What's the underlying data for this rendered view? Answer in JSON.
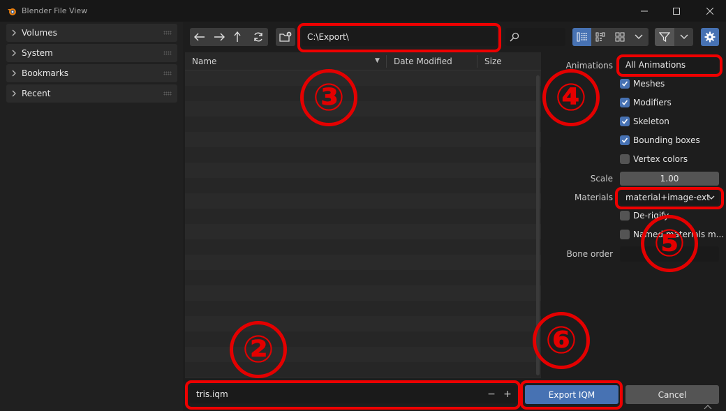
{
  "window": {
    "title": "Blender File View",
    "minimize_glyph": "—",
    "maximize_glyph": "☐",
    "close_glyph": "✕"
  },
  "sidebar": {
    "items": [
      {
        "label": "Volumes"
      },
      {
        "label": "System"
      },
      {
        "label": "Bookmarks"
      },
      {
        "label": "Recent"
      }
    ]
  },
  "toolbar": {
    "path": "C:\\Export\\",
    "search_placeholder": ""
  },
  "file_list": {
    "columns": [
      "Name",
      "Date Modified",
      "Size"
    ],
    "sort_indicator": "▼"
  },
  "options": {
    "animations_label": "Animations",
    "animations_value": "All Animations",
    "checkboxes": [
      {
        "label": "Meshes",
        "checked": true
      },
      {
        "label": "Modifiers",
        "checked": true
      },
      {
        "label": "Skeleton",
        "checked": true
      },
      {
        "label": "Bounding boxes",
        "checked": true
      },
      {
        "label": "Vertex colors",
        "checked": false
      }
    ],
    "scale_label": "Scale",
    "scale_value": "1.00",
    "materials_label": "Materials",
    "materials_value": "material+image-ext",
    "deriggify_label": "De-rigify",
    "named_materials_label": "Named materials m...",
    "deriggify_checked": false,
    "named_materials_checked": false,
    "bone_order_label": "Bone order",
    "bone_order_value": ""
  },
  "bottom": {
    "filename": "tris.iqm",
    "minus": "−",
    "plus": "+",
    "export_label": "Export IQM",
    "cancel_label": "Cancel"
  },
  "annotations": {
    "marks": [
      "②",
      "③",
      "④",
      "⑤",
      "⑥"
    ],
    "color": "#e40000"
  },
  "colors": {
    "accent": "#4772b3",
    "highlight": "#ee0000"
  }
}
